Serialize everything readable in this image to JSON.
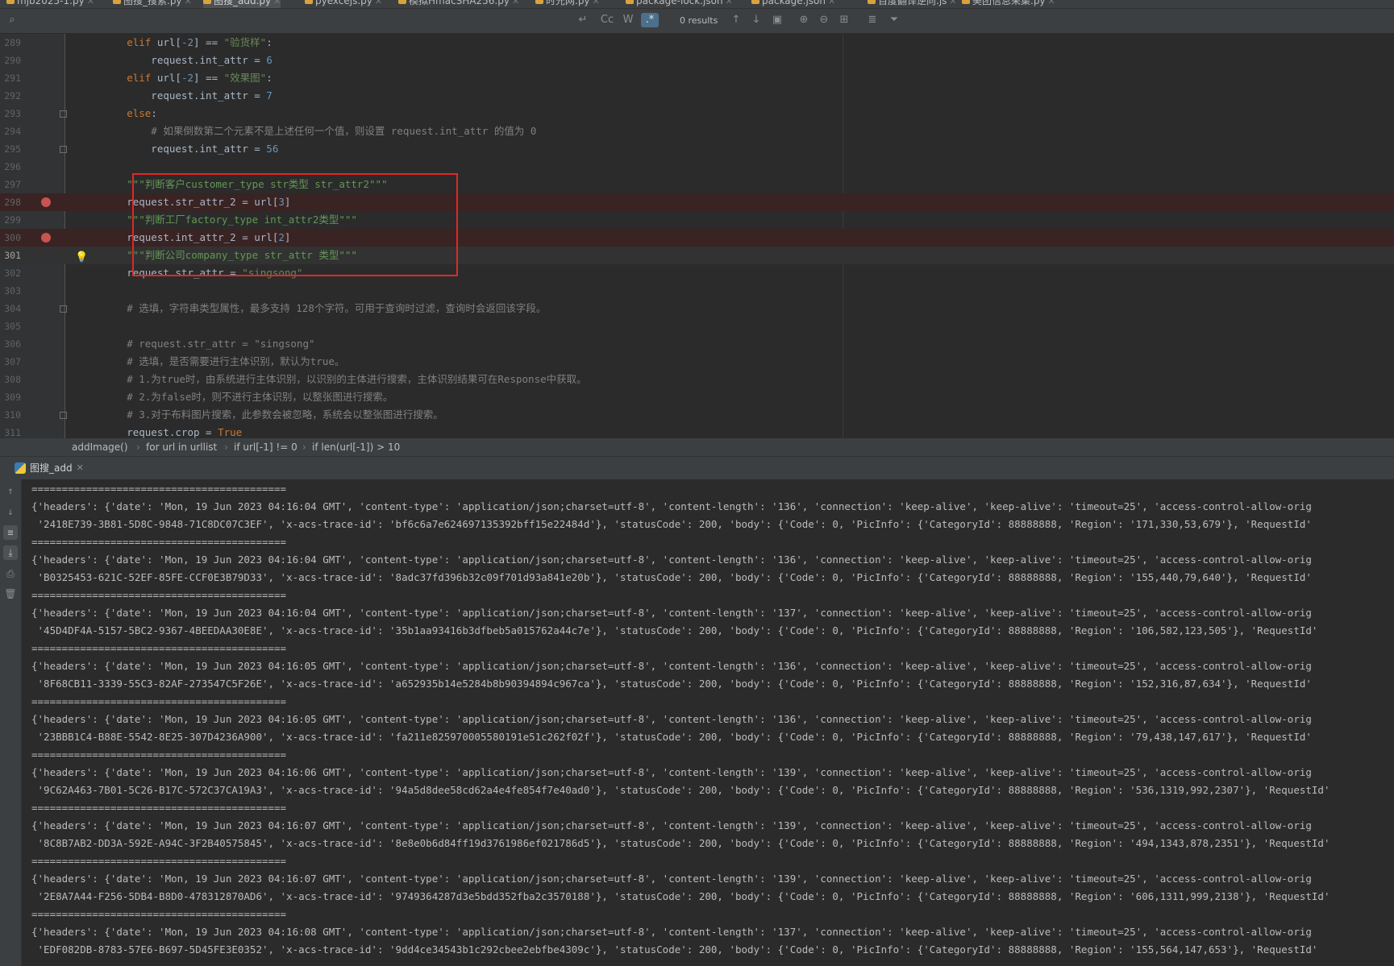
{
  "tabs": [
    {
      "label": "mjb2025-1.py",
      "active": false
    },
    {
      "label": "图搜_搜索.py",
      "active": false
    },
    {
      "label": "图搜_add.py",
      "active": true
    },
    {
      "label": "pyexcejs.py",
      "active": false
    },
    {
      "label": "模拟HmacSHA256.py",
      "active": false
    },
    {
      "label": "时光网.py",
      "active": false
    },
    {
      "label": "package-lock.json",
      "active": false
    },
    {
      "label": "package.json",
      "active": false
    },
    {
      "label": "百度翻译逆向.js",
      "active": false
    },
    {
      "label": "美团信息采集.py",
      "active": false
    }
  ],
  "search": {
    "placeholder": "",
    "results": "0 results",
    "match_case": "Cc",
    "words": "W",
    "regex": ".*"
  },
  "editor": {
    "lines": [
      {
        "n": "289",
        "segs": [
          [
            "kw",
            "        elif "
          ],
          [
            "",
            "url["
          ],
          [
            "num",
            "-2"
          ],
          [
            "",
            "] == "
          ],
          [
            "str",
            "\"验货样\""
          ],
          [
            "",
            ":"
          ]
        ]
      },
      {
        "n": "290",
        "segs": [
          [
            "",
            "            request.int_attr = "
          ],
          [
            "num",
            "6"
          ]
        ]
      },
      {
        "n": "291",
        "segs": [
          [
            "kw",
            "        elif "
          ],
          [
            "",
            "url["
          ],
          [
            "num",
            "-2"
          ],
          [
            "",
            "] == "
          ],
          [
            "str",
            "\"效果图\""
          ],
          [
            "",
            ":"
          ]
        ]
      },
      {
        "n": "292",
        "segs": [
          [
            "",
            "            request.int_attr = "
          ],
          [
            "num",
            "7"
          ]
        ]
      },
      {
        "n": "293",
        "fold": true,
        "segs": [
          [
            "kw",
            "        else"
          ],
          [
            "",
            ":"
          ]
        ]
      },
      {
        "n": "294",
        "segs": [
          [
            "cmt",
            "            # 如果倒数第二个元素不是上述任何一个值，则设置 request.int_attr 的值为 0"
          ]
        ]
      },
      {
        "n": "295",
        "fold": true,
        "segs": [
          [
            "",
            "            request.int_attr = "
          ],
          [
            "num",
            "56"
          ]
        ]
      },
      {
        "n": "296",
        "segs": []
      },
      {
        "n": "297",
        "segs": [
          [
            "doc",
            "        \"\"\"判断客户customer_type str类型 str_attr2\"\"\""
          ]
        ]
      },
      {
        "n": "298",
        "bp": true,
        "segs": [
          [
            "",
            "        request.str_attr_2 = url["
          ],
          [
            "num",
            "3"
          ],
          [
            "",
            "]"
          ]
        ]
      },
      {
        "n": "299",
        "segs": [
          [
            "doc",
            "        \"\"\"判断工厂factory_type int_attr2类型\"\"\""
          ]
        ]
      },
      {
        "n": "300",
        "bp": true,
        "segs": [
          [
            "",
            "        request.int_attr_2 = url["
          ],
          [
            "num",
            "2"
          ],
          [
            "",
            "]"
          ]
        ]
      },
      {
        "n": "301",
        "caret": true,
        "bulb": true,
        "segs": [
          [
            "doc",
            "        \"\"\"判断公司company_type str_attr 类型\"\"\""
          ]
        ]
      },
      {
        "n": "302",
        "segs": [
          [
            "",
            "        request.str_attr = "
          ],
          [
            "str",
            "\"singsong\""
          ]
        ]
      },
      {
        "n": "303",
        "segs": []
      },
      {
        "n": "304",
        "fold": true,
        "segs": [
          [
            "cmt",
            "        # 选填，字符串类型属性，最多支持 128个字符。可用于查询时过滤，查询时会返回该字段。"
          ]
        ]
      },
      {
        "n": "305",
        "segs": []
      },
      {
        "n": "306",
        "segs": [
          [
            "cmt",
            "        # request.str_attr = \"singsong\""
          ]
        ]
      },
      {
        "n": "307",
        "segs": [
          [
            "cmt",
            "        # 选填，是否需要进行主体识别，默认为true。"
          ]
        ]
      },
      {
        "n": "308",
        "segs": [
          [
            "cmt",
            "        # 1.为true时，由系统进行主体识别，以识别的主体进行搜索，主体识别结果可在Response中获取。"
          ]
        ]
      },
      {
        "n": "309",
        "segs": [
          [
            "cmt",
            "        # 2.为false时，则不进行主体识别，以整张图进行搜索。"
          ]
        ]
      },
      {
        "n": "310",
        "fold": true,
        "segs": [
          [
            "cmt",
            "        # 3.对于布料图片搜索，此参数会被忽略，系统会以整张图进行搜索。"
          ]
        ]
      },
      {
        "n": "311",
        "segs": [
          [
            "",
            "        request.crop = "
          ],
          [
            "kw",
            "True"
          ]
        ]
      }
    ]
  },
  "breadcrumb": [
    "addImage()",
    "for url in urllist",
    "if url[-1] != 0",
    "if len(url[-1]) > 10"
  ],
  "run": {
    "tab_label": "图搜_add",
    "separator": "==========================================",
    "entries": [
      {
        "time": "04:16:04",
        "len": "136",
        "req": "2418E739-3B81-5D8C-9848-71C8DC07C3EF",
        "trace": "bf6c6a7e624697135392bff15e22484d",
        "region": "171,330,53,679"
      },
      {
        "time": "04:16:04",
        "len": "136",
        "req": "B0325453-621C-52EF-85FE-CCF0E3B79D33",
        "trace": "8adc37fd396b32c09f701d93a841e20b",
        "region": "155,440,79,640"
      },
      {
        "time": "04:16:04",
        "len": "137",
        "req": "45D4DF4A-5157-5BC2-9367-4BEEDAA30E8E",
        "trace": "35b1aa93416b3dfbeb5a015762a44c7e",
        "region": "106,582,123,505"
      },
      {
        "time": "04:16:05",
        "len": "136",
        "req": "8F68CB11-3339-55C3-82AF-273547C5F26E",
        "trace": "a652935b14e5284b8b90394894c967ca",
        "region": "152,316,87,634"
      },
      {
        "time": "04:16:05",
        "len": "136",
        "req": "23BBB1C4-B88E-5542-8E25-307D4236A900",
        "trace": "fa211e825970005580191e51c262f02f",
        "region": "79,438,147,617"
      },
      {
        "time": "04:16:06",
        "len": "139",
        "req": "9C62A463-7B01-5C26-B17C-572C37CA19A3",
        "trace": "94a5d8dee58cd62a4e4fe854f7e40ad0",
        "region": "536,1319,992,2307"
      },
      {
        "time": "04:16:07",
        "len": "139",
        "req": "8C8B7AB2-DD3A-592E-A94C-3F2B40575845",
        "trace": "8e8e0b6d84ff19d3761986ef021786d5",
        "region": "494,1343,878,2351"
      },
      {
        "time": "04:16:07",
        "len": "139",
        "req": "2E8A7A44-F256-5DB4-B8D0-478312870AD6",
        "trace": "9749364287d3e5bdd352fba2c3570188",
        "region": "606,1311,999,2138"
      },
      {
        "time": "04:16:08",
        "len": "137",
        "req": "EDF082DB-8783-57E6-B697-5D45FE3E0352",
        "trace": "9dd4ce34543b1c292cbee2ebfbe4309c",
        "region": "155,564,147,653"
      }
    ]
  },
  "icons": [
    "search-icon",
    "arrow-up-icon",
    "arrow-down-icon",
    "filter-icon",
    "breakpoint-icon",
    "bulb-icon",
    "python-file-icon",
    "close-icon",
    "soft-wrap-icon",
    "scroll-to-end-icon",
    "print-icon",
    "trash-icon"
  ],
  "colors": {
    "breakpoint": "#c75450",
    "highlight_box": "#e02828",
    "keyword": "#cc7832",
    "string": "#6a8759",
    "number": "#6897bb"
  }
}
